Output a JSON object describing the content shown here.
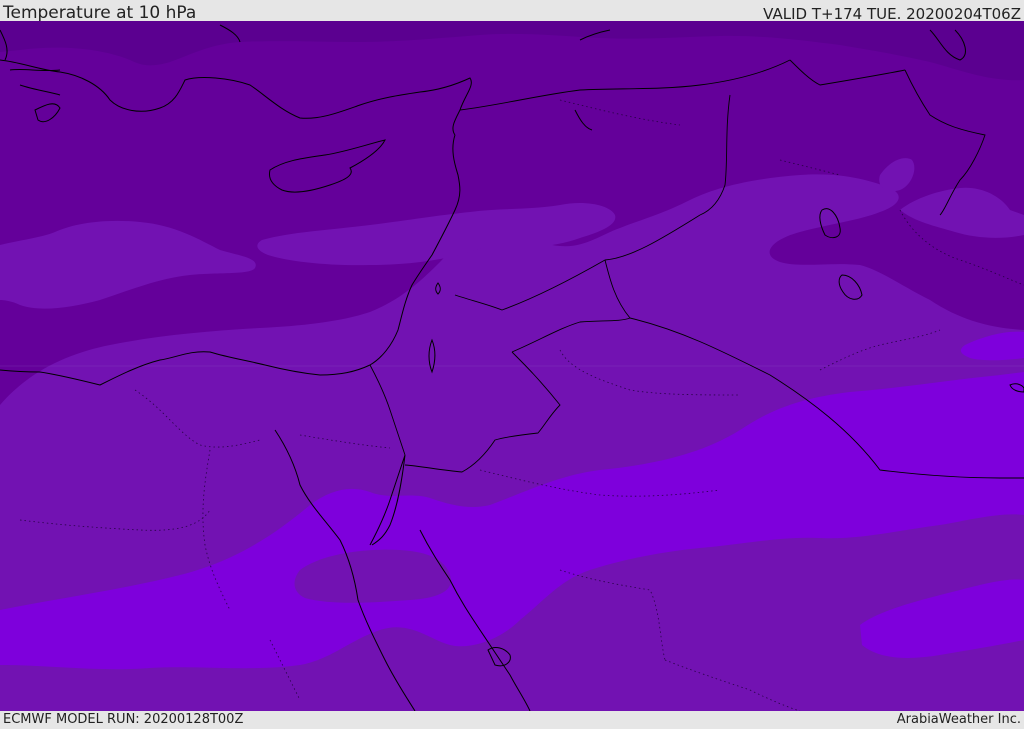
{
  "header": {
    "title": "Temperature at 10 hPa",
    "valid": "VALID T+174 TUE. 20200204T06Z"
  },
  "footer": {
    "model_run": "ECMWF MODEL RUN: 20200128T00Z",
    "credit": "ArabiaWeather Inc."
  },
  "colors": {
    "band_darkest": "#5b0090",
    "band_dark": "#64009a",
    "band_mid": "#7212b2",
    "band_light": "#7e00dc",
    "coastline": "#000000",
    "border": "#000000"
  }
}
